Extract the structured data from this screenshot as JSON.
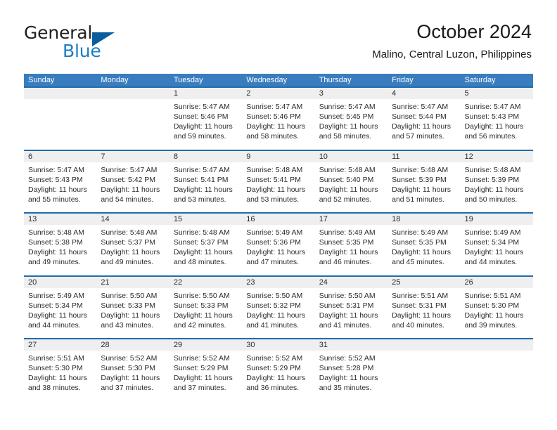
{
  "logo": {
    "text_top": "General",
    "text_bottom": "Blue",
    "triangle_color": "#0a5c9e",
    "blue_color": "#1d7dc4"
  },
  "header": {
    "title": "October 2024",
    "subtitle": "Malino, Central Luzon, Philippines"
  },
  "theme": {
    "header_blue": "#3a7dbf",
    "row_rule_blue": "#1f6cb0",
    "day_strip_gray": "#efefef",
    "text_color": "#2b2b2b"
  },
  "calendar": {
    "weekdays": [
      "Sunday",
      "Monday",
      "Tuesday",
      "Wednesday",
      "Thursday",
      "Friday",
      "Saturday"
    ],
    "weeks": [
      [
        {
          "day": "",
          "sunrise": "",
          "sunset": "",
          "daylight_1": "",
          "daylight_2": ""
        },
        {
          "day": "",
          "sunrise": "",
          "sunset": "",
          "daylight_1": "",
          "daylight_2": ""
        },
        {
          "day": "1",
          "sunrise": "Sunrise: 5:47 AM",
          "sunset": "Sunset: 5:46 PM",
          "daylight_1": "Daylight: 11 hours",
          "daylight_2": "and 59 minutes."
        },
        {
          "day": "2",
          "sunrise": "Sunrise: 5:47 AM",
          "sunset": "Sunset: 5:46 PM",
          "daylight_1": "Daylight: 11 hours",
          "daylight_2": "and 58 minutes."
        },
        {
          "day": "3",
          "sunrise": "Sunrise: 5:47 AM",
          "sunset": "Sunset: 5:45 PM",
          "daylight_1": "Daylight: 11 hours",
          "daylight_2": "and 58 minutes."
        },
        {
          "day": "4",
          "sunrise": "Sunrise: 5:47 AM",
          "sunset": "Sunset: 5:44 PM",
          "daylight_1": "Daylight: 11 hours",
          "daylight_2": "and 57 minutes."
        },
        {
          "day": "5",
          "sunrise": "Sunrise: 5:47 AM",
          "sunset": "Sunset: 5:43 PM",
          "daylight_1": "Daylight: 11 hours",
          "daylight_2": "and 56 minutes."
        }
      ],
      [
        {
          "day": "6",
          "sunrise": "Sunrise: 5:47 AM",
          "sunset": "Sunset: 5:43 PM",
          "daylight_1": "Daylight: 11 hours",
          "daylight_2": "and 55 minutes."
        },
        {
          "day": "7",
          "sunrise": "Sunrise: 5:47 AM",
          "sunset": "Sunset: 5:42 PM",
          "daylight_1": "Daylight: 11 hours",
          "daylight_2": "and 54 minutes."
        },
        {
          "day": "8",
          "sunrise": "Sunrise: 5:47 AM",
          "sunset": "Sunset: 5:41 PM",
          "daylight_1": "Daylight: 11 hours",
          "daylight_2": "and 53 minutes."
        },
        {
          "day": "9",
          "sunrise": "Sunrise: 5:48 AM",
          "sunset": "Sunset: 5:41 PM",
          "daylight_1": "Daylight: 11 hours",
          "daylight_2": "and 53 minutes."
        },
        {
          "day": "10",
          "sunrise": "Sunrise: 5:48 AM",
          "sunset": "Sunset: 5:40 PM",
          "daylight_1": "Daylight: 11 hours",
          "daylight_2": "and 52 minutes."
        },
        {
          "day": "11",
          "sunrise": "Sunrise: 5:48 AM",
          "sunset": "Sunset: 5:39 PM",
          "daylight_1": "Daylight: 11 hours",
          "daylight_2": "and 51 minutes."
        },
        {
          "day": "12",
          "sunrise": "Sunrise: 5:48 AM",
          "sunset": "Sunset: 5:39 PM",
          "daylight_1": "Daylight: 11 hours",
          "daylight_2": "and 50 minutes."
        }
      ],
      [
        {
          "day": "13",
          "sunrise": "Sunrise: 5:48 AM",
          "sunset": "Sunset: 5:38 PM",
          "daylight_1": "Daylight: 11 hours",
          "daylight_2": "and 49 minutes."
        },
        {
          "day": "14",
          "sunrise": "Sunrise: 5:48 AM",
          "sunset": "Sunset: 5:37 PM",
          "daylight_1": "Daylight: 11 hours",
          "daylight_2": "and 49 minutes."
        },
        {
          "day": "15",
          "sunrise": "Sunrise: 5:48 AM",
          "sunset": "Sunset: 5:37 PM",
          "daylight_1": "Daylight: 11 hours",
          "daylight_2": "and 48 minutes."
        },
        {
          "day": "16",
          "sunrise": "Sunrise: 5:49 AM",
          "sunset": "Sunset: 5:36 PM",
          "daylight_1": "Daylight: 11 hours",
          "daylight_2": "and 47 minutes."
        },
        {
          "day": "17",
          "sunrise": "Sunrise: 5:49 AM",
          "sunset": "Sunset: 5:35 PM",
          "daylight_1": "Daylight: 11 hours",
          "daylight_2": "and 46 minutes."
        },
        {
          "day": "18",
          "sunrise": "Sunrise: 5:49 AM",
          "sunset": "Sunset: 5:35 PM",
          "daylight_1": "Daylight: 11 hours",
          "daylight_2": "and 45 minutes."
        },
        {
          "day": "19",
          "sunrise": "Sunrise: 5:49 AM",
          "sunset": "Sunset: 5:34 PM",
          "daylight_1": "Daylight: 11 hours",
          "daylight_2": "and 44 minutes."
        }
      ],
      [
        {
          "day": "20",
          "sunrise": "Sunrise: 5:49 AM",
          "sunset": "Sunset: 5:34 PM",
          "daylight_1": "Daylight: 11 hours",
          "daylight_2": "and 44 minutes."
        },
        {
          "day": "21",
          "sunrise": "Sunrise: 5:50 AM",
          "sunset": "Sunset: 5:33 PM",
          "daylight_1": "Daylight: 11 hours",
          "daylight_2": "and 43 minutes."
        },
        {
          "day": "22",
          "sunrise": "Sunrise: 5:50 AM",
          "sunset": "Sunset: 5:33 PM",
          "daylight_1": "Daylight: 11 hours",
          "daylight_2": "and 42 minutes."
        },
        {
          "day": "23",
          "sunrise": "Sunrise: 5:50 AM",
          "sunset": "Sunset: 5:32 PM",
          "daylight_1": "Daylight: 11 hours",
          "daylight_2": "and 41 minutes."
        },
        {
          "day": "24",
          "sunrise": "Sunrise: 5:50 AM",
          "sunset": "Sunset: 5:31 PM",
          "daylight_1": "Daylight: 11 hours",
          "daylight_2": "and 41 minutes."
        },
        {
          "day": "25",
          "sunrise": "Sunrise: 5:51 AM",
          "sunset": "Sunset: 5:31 PM",
          "daylight_1": "Daylight: 11 hours",
          "daylight_2": "and 40 minutes."
        },
        {
          "day": "26",
          "sunrise": "Sunrise: 5:51 AM",
          "sunset": "Sunset: 5:30 PM",
          "daylight_1": "Daylight: 11 hours",
          "daylight_2": "and 39 minutes."
        }
      ],
      [
        {
          "day": "27",
          "sunrise": "Sunrise: 5:51 AM",
          "sunset": "Sunset: 5:30 PM",
          "daylight_1": "Daylight: 11 hours",
          "daylight_2": "and 38 minutes."
        },
        {
          "day": "28",
          "sunrise": "Sunrise: 5:52 AM",
          "sunset": "Sunset: 5:30 PM",
          "daylight_1": "Daylight: 11 hours",
          "daylight_2": "and 37 minutes."
        },
        {
          "day": "29",
          "sunrise": "Sunrise: 5:52 AM",
          "sunset": "Sunset: 5:29 PM",
          "daylight_1": "Daylight: 11 hours",
          "daylight_2": "and 37 minutes."
        },
        {
          "day": "30",
          "sunrise": "Sunrise: 5:52 AM",
          "sunset": "Sunset: 5:29 PM",
          "daylight_1": "Daylight: 11 hours",
          "daylight_2": "and 36 minutes."
        },
        {
          "day": "31",
          "sunrise": "Sunrise: 5:52 AM",
          "sunset": "Sunset: 5:28 PM",
          "daylight_1": "Daylight: 11 hours",
          "daylight_2": "and 35 minutes."
        },
        {
          "day": "",
          "sunrise": "",
          "sunset": "",
          "daylight_1": "",
          "daylight_2": ""
        },
        {
          "day": "",
          "sunrise": "",
          "sunset": "",
          "daylight_1": "",
          "daylight_2": ""
        }
      ]
    ]
  }
}
